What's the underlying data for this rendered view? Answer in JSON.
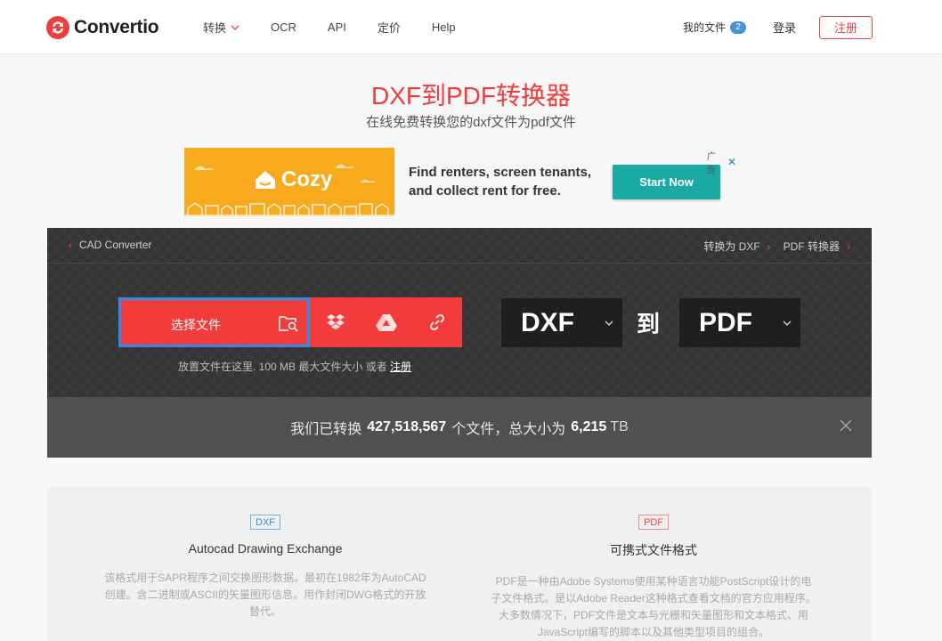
{
  "brand": {
    "name": "Convertio",
    "color": "#ef3d3d"
  },
  "nav": {
    "items": [
      {
        "label": "转换",
        "has_dropdown": true
      },
      {
        "label": "OCR"
      },
      {
        "label": "API"
      },
      {
        "label": "定价"
      },
      {
        "label": "Help"
      }
    ],
    "my_files": "我的文件",
    "my_files_count": "2",
    "login": "登录",
    "signup": "注册"
  },
  "hero": {
    "title": "DXF到PDF转换器",
    "subtitle": "在线免费转换您的dxf文件为pdf文件"
  },
  "ad": {
    "brand": "Cozy",
    "copy": "Find renters, screen tenants, and collect rent for free.",
    "cta": "Start Now",
    "flag": "广告",
    "colors": {
      "background": "#f6aa1c",
      "cta": "#1ba9a4"
    }
  },
  "converter": {
    "crumb_left": "CAD Converter",
    "crumb_right_1": "转换为 DXF",
    "crumb_right_2": "PDF 转换器",
    "choose_file": "选择文件",
    "sources": [
      "dropbox-icon",
      "google-drive-icon",
      "url-link-icon"
    ],
    "hint_text": "放置文件在这里. 100 MB 最大文件大小 或者",
    "hint_link": "注册",
    "from_format": "DXF",
    "to_label": "到",
    "to_format": "PDF"
  },
  "stats": {
    "prefix": "我们已转换",
    "files_count": "427,518,567",
    "middle": "个文件，总大小为",
    "total_size": "6,215",
    "unit": "TB"
  },
  "info": {
    "left": {
      "tag": "DXF",
      "title": "Autocad Drawing Exchange",
      "desc": "该格式用于SAPR程序之间交换图形数据。最初在1982年为AutoCAD创建。含二进制或ASCII的矢量图形信息。用作封闭DWG格式的开放替代。"
    },
    "right": {
      "tag": "PDF",
      "title": "可携式文件格式",
      "desc": "PDF是一种由Adobe Systems使用某种语言功能PostScript设计的电子文件格式。是以Adobe Reader这种格式查看文档的官方应用程序。大多数情况下，PDF文件是文本与光栅和矢量图形和文本格式、用JavaScript编写的脚本以及其他类型项目的组合。"
    }
  }
}
